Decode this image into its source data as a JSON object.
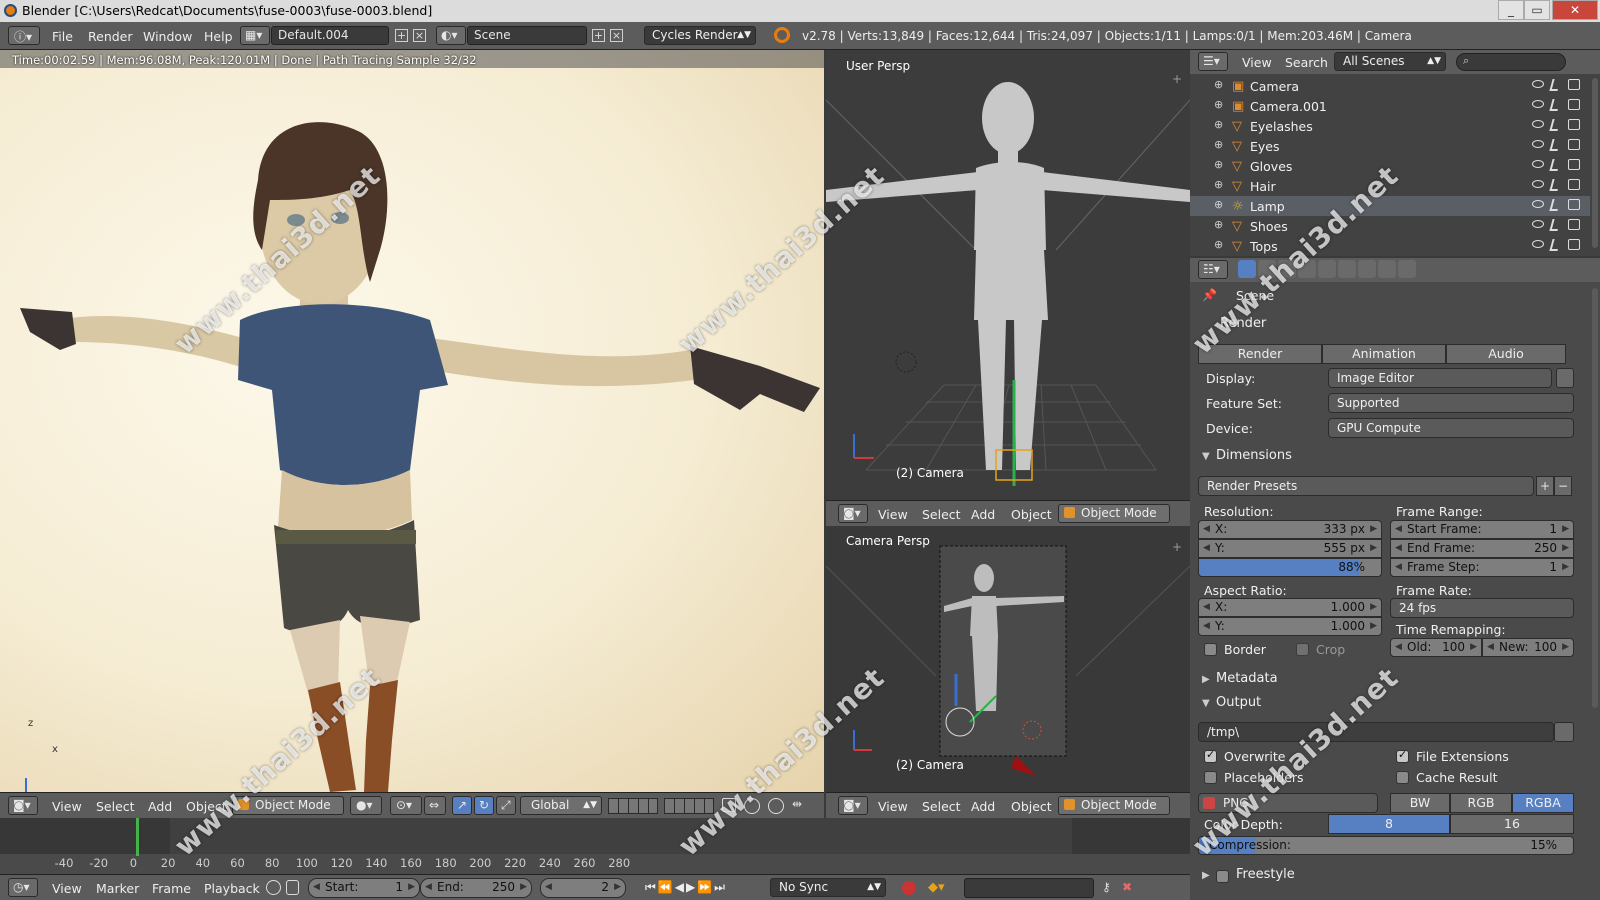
{
  "window": {
    "title": "Blender [C:\\Users\\Redcat\\Documents\\fuse-0003\\fuse-0003.blend]",
    "buttons": [
      "_",
      "▭",
      "✕"
    ]
  },
  "topbar": {
    "menus": [
      "File",
      "Render",
      "Window",
      "Help"
    ],
    "layout": "Default.004",
    "scene": "Scene",
    "engine": "Cycles Render",
    "stats": "v2.78 | Verts:13,849 | Faces:12,644 | Tris:24,097 | Objects:1/11 | Lamps:0/1 | Mem:203.46M | Camera"
  },
  "render_view": {
    "info": "Time:00:02.59 | Mem:96.08M, Peak:120.01M | Done | Path Tracing Sample 32/32",
    "axis": {
      "x": "x",
      "z": "z"
    }
  },
  "view_header_left": {
    "menus": [
      "View",
      "Select",
      "Add",
      "Object"
    ],
    "mode": "Object Mode",
    "orientation": "Global"
  },
  "viewport_top": {
    "label": "User Persp",
    "camera_label": "(2) Camera",
    "menus": [
      "View",
      "Select",
      "Add",
      "Object"
    ],
    "mode": "Object Mode"
  },
  "viewport_bottom": {
    "label": "Camera Persp",
    "camera_label": "(2) Camera",
    "menus": [
      "View",
      "Select",
      "Add",
      "Object"
    ],
    "mode": "Object Mode"
  },
  "outliner": {
    "menus": [
      "View",
      "Search"
    ],
    "filter": "All Scenes",
    "items": [
      {
        "name": "Camera",
        "type": "camera"
      },
      {
        "name": "Camera.001",
        "type": "camera"
      },
      {
        "name": "Eyelashes",
        "type": "mesh"
      },
      {
        "name": "Eyes",
        "type": "mesh"
      },
      {
        "name": "Gloves",
        "type": "mesh"
      },
      {
        "name": "Hair",
        "type": "mesh"
      },
      {
        "name": "Lamp",
        "type": "lamp"
      },
      {
        "name": "Shoes",
        "type": "mesh"
      },
      {
        "name": "Tops",
        "type": "mesh"
      }
    ]
  },
  "properties": {
    "breadcrumb": "Scene",
    "render_panel": "Render",
    "render_buttons": [
      "Render",
      "Animation",
      "Audio"
    ],
    "display_label": "Display:",
    "display_value": "Image Editor",
    "featureset_label": "Feature Set:",
    "featureset_value": "Supported",
    "device_label": "Device:",
    "device_value": "GPU Compute",
    "dimensions": "Dimensions",
    "render_presets": "Render Presets",
    "resolution_label": "Resolution:",
    "res_x_label": "X:",
    "res_x": "333 px",
    "res_y_label": "Y:",
    "res_y": "555 px",
    "res_pct": "88%",
    "aspect_label": "Aspect Ratio:",
    "asp_x_label": "X:",
    "asp_x": "1.000",
    "asp_y_label": "Y:",
    "asp_y": "1.000",
    "border": "Border",
    "crop": "Crop",
    "frame_range_label": "Frame Range:",
    "start_label": "Start Frame:",
    "start": "1",
    "end_label": "End Frame:",
    "end": "250",
    "step_label": "Frame Step:",
    "step": "1",
    "frame_rate_label": "Frame Rate:",
    "frame_rate": "24 fps",
    "remap_label": "Time Remapping:",
    "old_label": "Old:",
    "old": "100",
    "new_label": "New:",
    "new": "100",
    "metadata": "Metadata",
    "output": "Output",
    "output_path": "/tmp\\",
    "overwrite": "Overwrite",
    "file_ext": "File Extensions",
    "placeholders": "Placeholders",
    "cache_result": "Cache Result",
    "format": "PNG",
    "color_modes": [
      "BW",
      "RGB",
      "RGBA"
    ],
    "color_depth_label": "Color Depth:",
    "depths": [
      "8",
      "16"
    ],
    "compression_label": "Compression:",
    "compression": "15%",
    "freestyle": "Freestyle"
  },
  "timeline": {
    "ticks": [
      "-40",
      "-20",
      "0",
      "20",
      "40",
      "60",
      "80",
      "100",
      "120",
      "140",
      "160",
      "180",
      "200",
      "220",
      "240",
      "260",
      "280"
    ],
    "current_frame_value": 2,
    "menus": [
      "View",
      "Marker",
      "Frame",
      "Playback"
    ],
    "start_label": "Start:",
    "start": "1",
    "end_label": "End:",
    "end": "250",
    "current": "2",
    "sync": "No Sync"
  },
  "watermark": "www.thai3d.net",
  "colors": {
    "accent_blue": "#5680c2",
    "header": "#5c5c5c",
    "render_bg": "#f5ecd3",
    "engine_orange": "#e87d0d"
  }
}
